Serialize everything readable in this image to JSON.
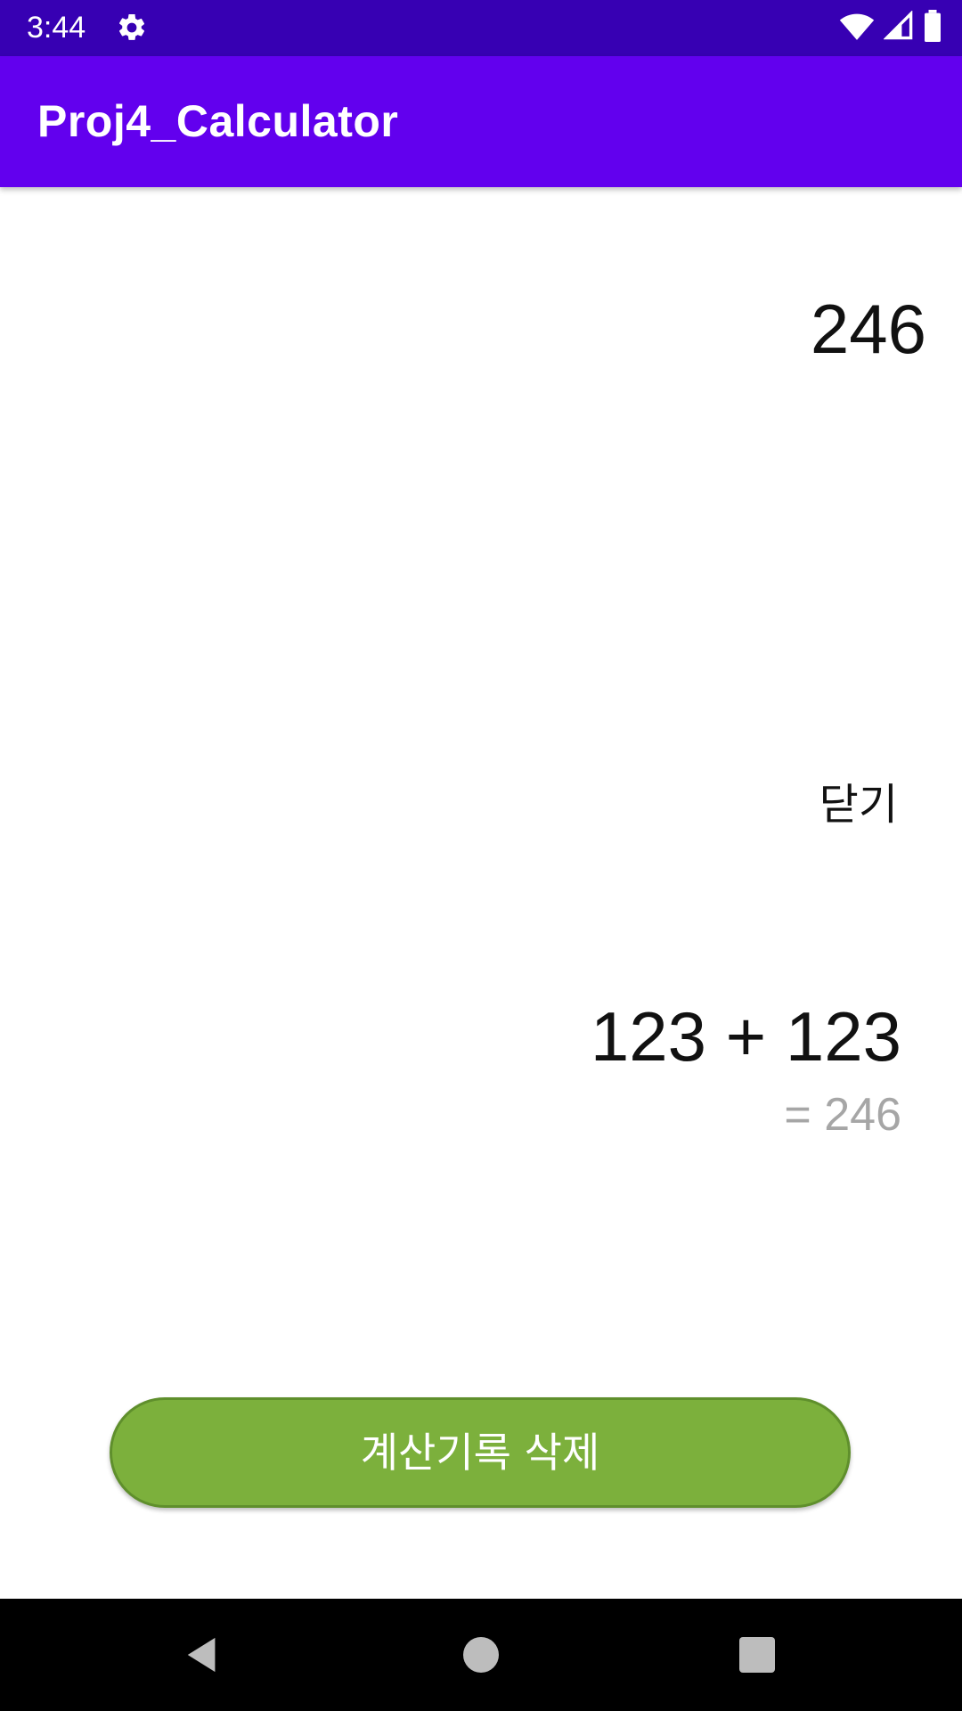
{
  "status_bar": {
    "time": "3:44",
    "icons": [
      "gear-icon",
      "wifi-icon",
      "cell-signal-icon",
      "battery-icon"
    ]
  },
  "app_bar": {
    "title": "Proj4_Calculator",
    "color": "#6200EE"
  },
  "display": {
    "result": "246"
  },
  "history_panel": {
    "close_label": "닫기",
    "entries": [
      {
        "expression": "123 + 123",
        "result": "= 246"
      }
    ],
    "delete_button_label": "계산기록 삭제",
    "delete_button_color": "#7CB03C"
  },
  "nav_bar": {
    "icons": [
      "back-icon",
      "home-icon",
      "recents-icon"
    ]
  }
}
